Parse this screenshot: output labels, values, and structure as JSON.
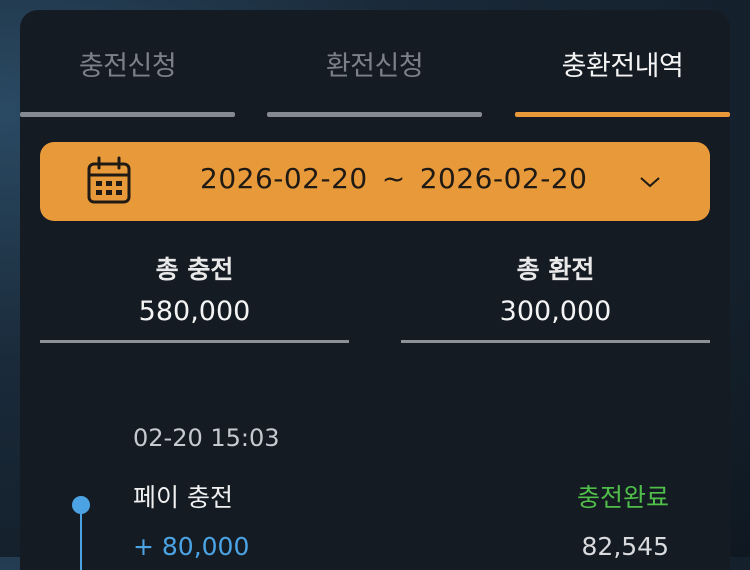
{
  "tabs": [
    {
      "label": "충전신청",
      "active": false
    },
    {
      "label": "환전신청",
      "active": false
    },
    {
      "label": "충환전내역",
      "active": true
    }
  ],
  "date_range": {
    "start": "2026-02-20",
    "separator": "~",
    "end": "2026-02-20",
    "icon": "calendar-icon",
    "dropdown_icon": "chevron-down-icon"
  },
  "totals": {
    "charge": {
      "label": "총 충전",
      "value": "580,000"
    },
    "exchange": {
      "label": "총 환전",
      "value": "300,000"
    }
  },
  "history": [
    {
      "time": "02-20 15:03",
      "title": "페이 충전",
      "status": "충전완료",
      "amount": "+ 80,000",
      "balance": "82,545"
    }
  ],
  "colors": {
    "accent": "#e8993a",
    "panel": "#151b23",
    "status_complete": "#4fbf4a",
    "timeline": "#4ba3e3"
  }
}
